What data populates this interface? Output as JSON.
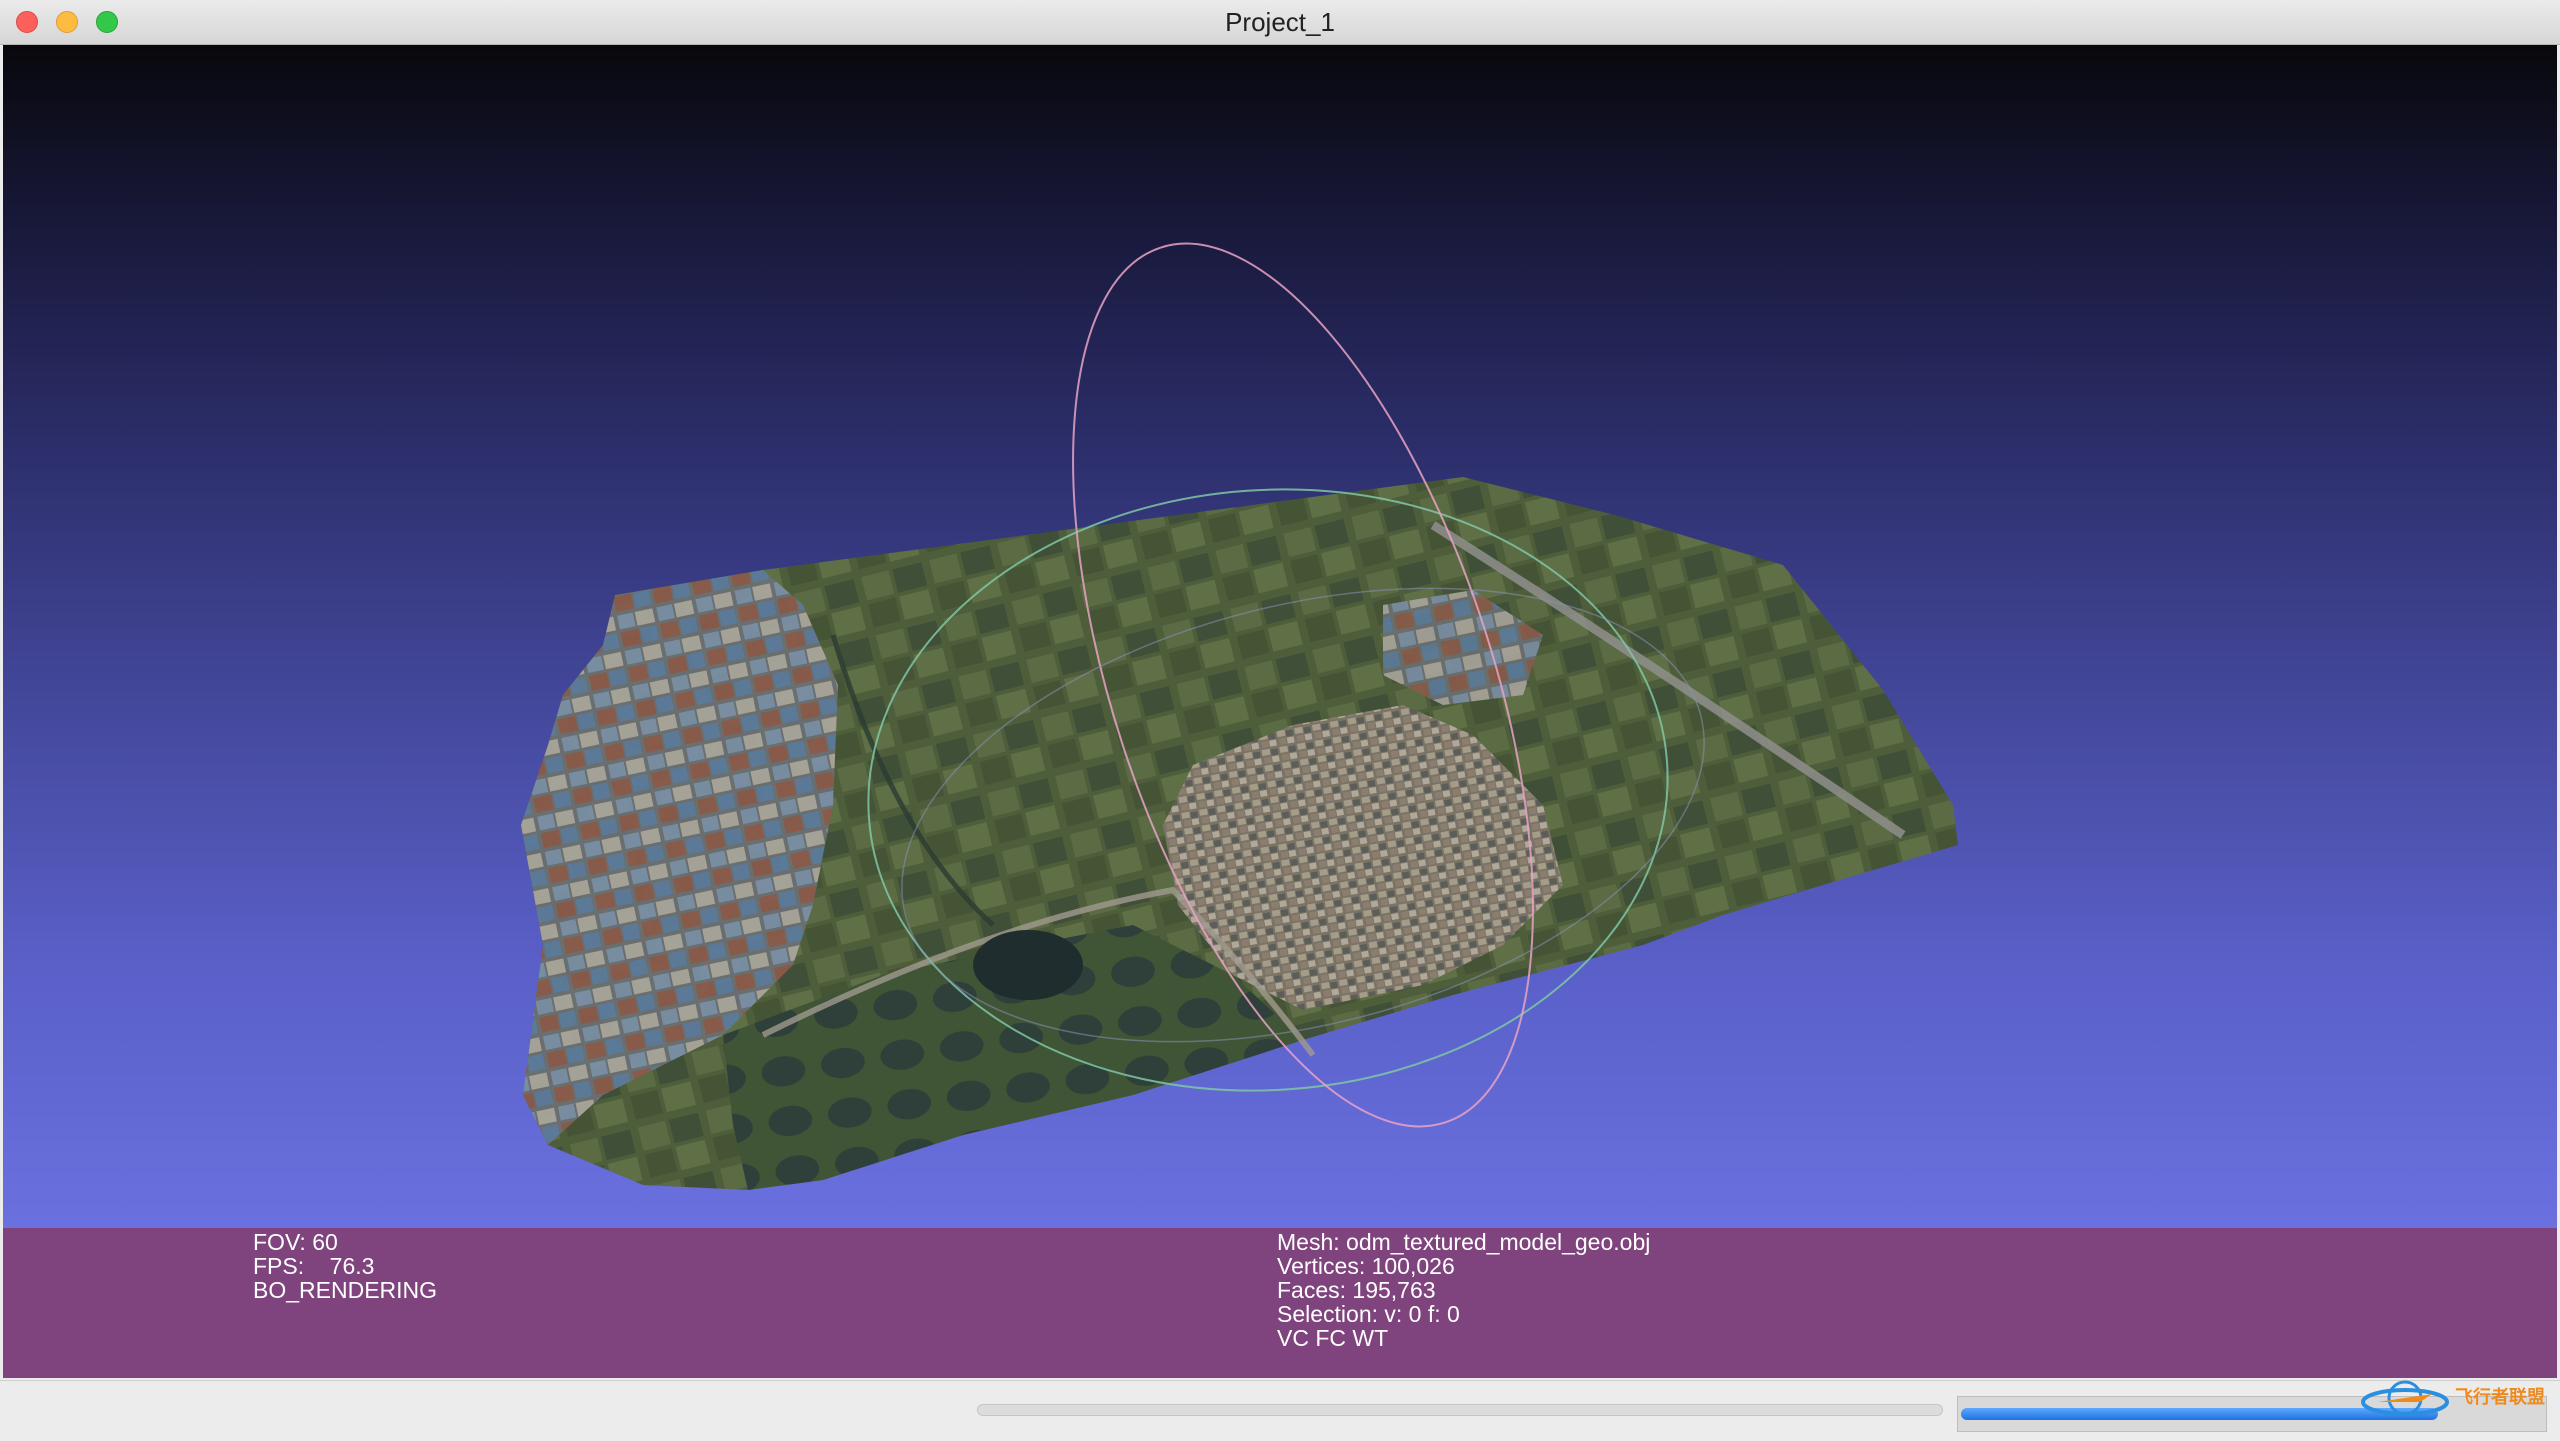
{
  "window": {
    "title": "Project_1"
  },
  "overlay": {
    "left": [
      "FOV: 60",
      "FPS:    76.3",
      "BO_RENDERING"
    ],
    "right": [
      "Mesh: odm_textured_model_geo.obj",
      "Vertices: 100,026",
      "Faces: 195,763",
      "Selection: v: 0 f: 0",
      "VC FC WT"
    ]
  },
  "progress": {
    "value": 0.82
  },
  "watermark": {
    "text": "飞行者联盟"
  },
  "colors": {
    "info_bar": "#7f437e",
    "trackball_green": "#7fc7a6",
    "trackball_red": "#e7a3c4"
  }
}
